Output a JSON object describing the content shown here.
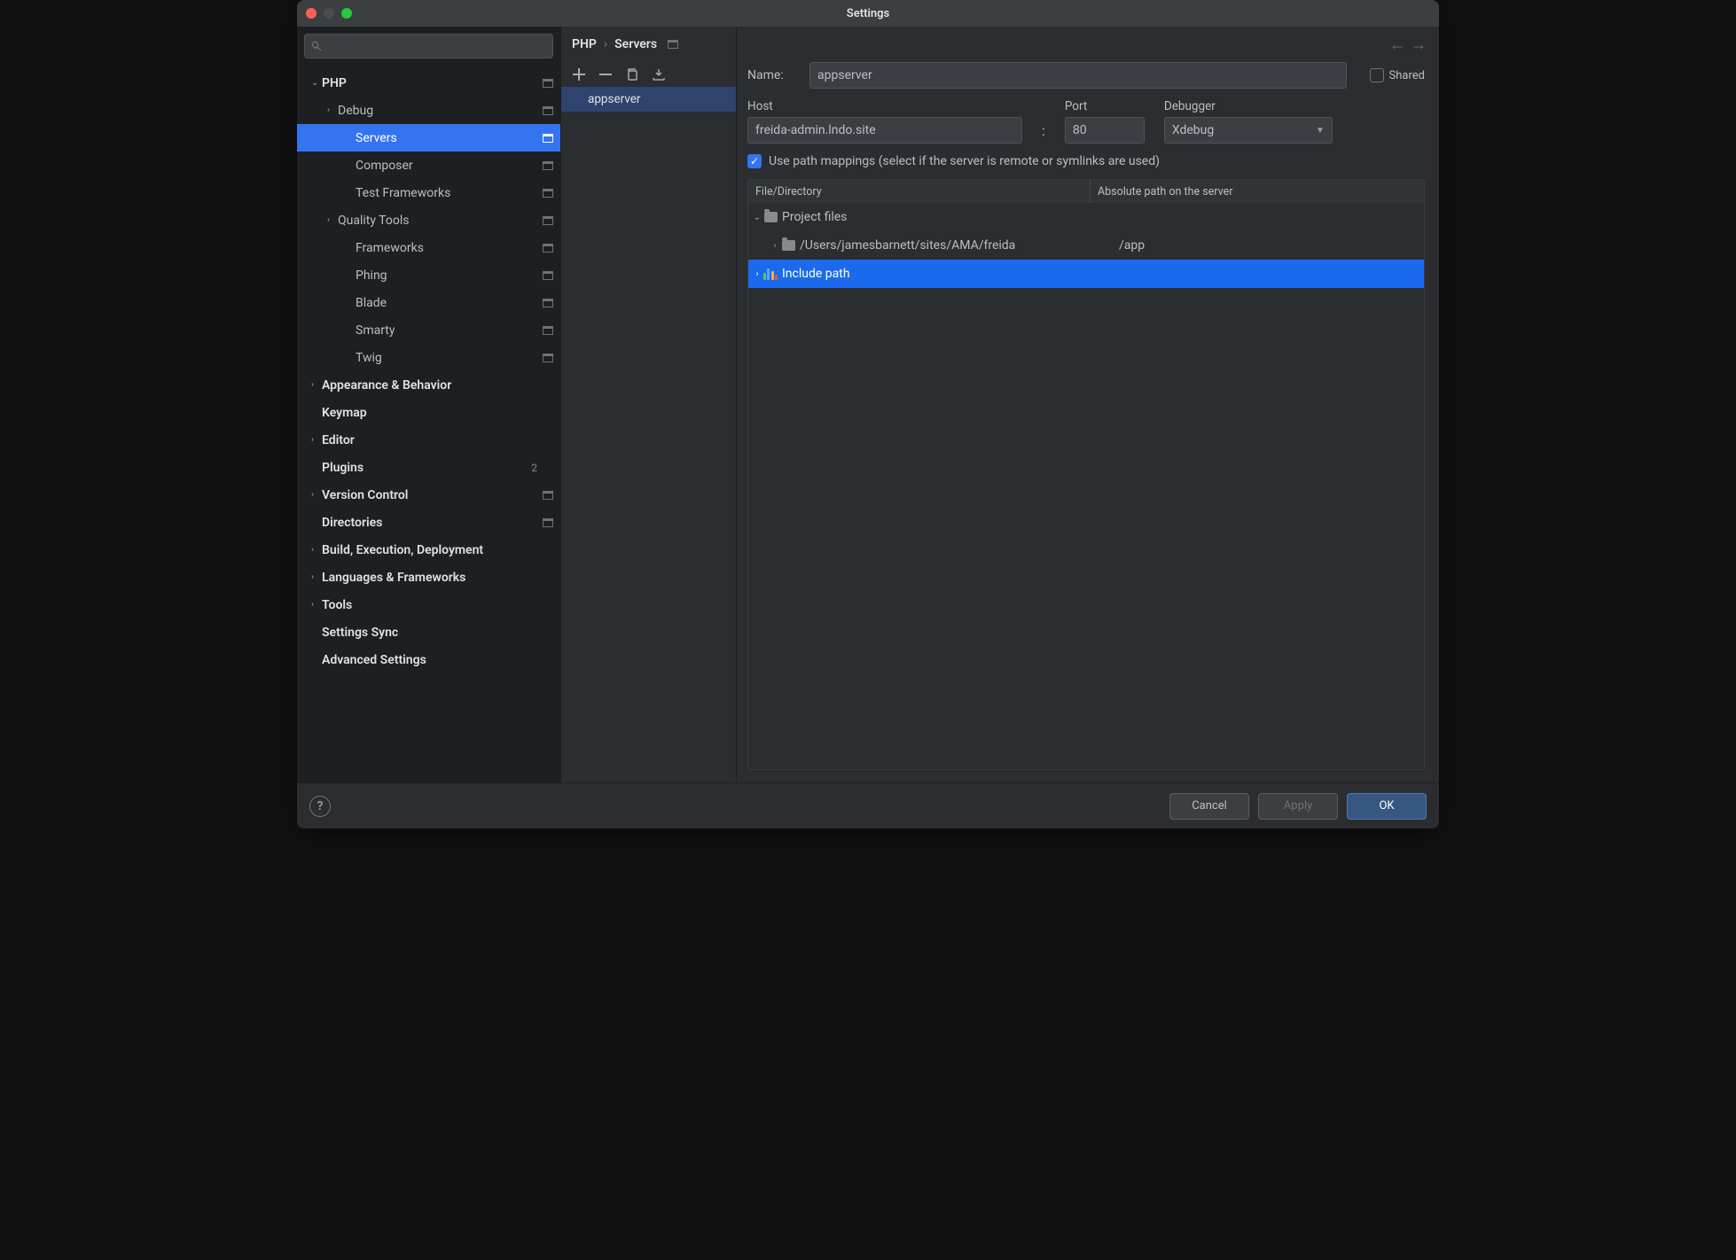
{
  "window": {
    "title": "Settings"
  },
  "sidebar": {
    "search_placeholder": "",
    "items": [
      {
        "label": "PHP",
        "depth": 0,
        "arrow": "⌄",
        "bold": true,
        "scope": true
      },
      {
        "label": "Debug",
        "depth": 1,
        "arrow": "›",
        "bold": false,
        "scope": true
      },
      {
        "label": "Servers",
        "depth": 2,
        "arrow": "",
        "bold": false,
        "scope": true,
        "selected": true
      },
      {
        "label": "Composer",
        "depth": 2,
        "arrow": "",
        "bold": false,
        "scope": true
      },
      {
        "label": "Test Frameworks",
        "depth": 2,
        "arrow": "",
        "bold": false,
        "scope": true
      },
      {
        "label": "Quality Tools",
        "depth": 1,
        "arrow": "›",
        "bold": false,
        "scope": true
      },
      {
        "label": "Frameworks",
        "depth": 2,
        "arrow": "",
        "bold": false,
        "scope": true
      },
      {
        "label": "Phing",
        "depth": 2,
        "arrow": "",
        "bold": false,
        "scope": true
      },
      {
        "label": "Blade",
        "depth": 2,
        "arrow": "",
        "bold": false,
        "scope": true
      },
      {
        "label": "Smarty",
        "depth": 2,
        "arrow": "",
        "bold": false,
        "scope": true
      },
      {
        "label": "Twig",
        "depth": 2,
        "arrow": "",
        "bold": false,
        "scope": true
      },
      {
        "label": "Appearance & Behavior",
        "depth": 0,
        "arrow": "›",
        "bold": true,
        "scope": false
      },
      {
        "label": "Keymap",
        "depth": 0,
        "arrow": "",
        "bold": true,
        "scope": false
      },
      {
        "label": "Editor",
        "depth": 0,
        "arrow": "›",
        "bold": true,
        "scope": false
      },
      {
        "label": "Plugins",
        "depth": 0,
        "arrow": "",
        "bold": true,
        "scope": false,
        "badge": "2"
      },
      {
        "label": "Version Control",
        "depth": 0,
        "arrow": "›",
        "bold": true,
        "scope": true
      },
      {
        "label": "Directories",
        "depth": 0,
        "arrow": "",
        "bold": true,
        "scope": true
      },
      {
        "label": "Build, Execution, Deployment",
        "depth": 0,
        "arrow": "›",
        "bold": true,
        "scope": false
      },
      {
        "label": "Languages & Frameworks",
        "depth": 0,
        "arrow": "›",
        "bold": true,
        "scope": false
      },
      {
        "label": "Tools",
        "depth": 0,
        "arrow": "›",
        "bold": true,
        "scope": false
      },
      {
        "label": "Settings Sync",
        "depth": 0,
        "arrow": "",
        "bold": true,
        "scope": false
      },
      {
        "label": "Advanced Settings",
        "depth": 0,
        "arrow": "",
        "bold": true,
        "scope": false
      }
    ]
  },
  "breadcrumb": {
    "root": "PHP",
    "sep": "›",
    "leaf": "Servers"
  },
  "servers": {
    "toolbar": {
      "add": "+",
      "remove": "−",
      "copy": "⧉",
      "import": "⭳"
    },
    "items": [
      "appserver"
    ]
  },
  "detail": {
    "name_label": "Name:",
    "name_value": "appserver",
    "shared_label": "Shared",
    "shared_checked": false,
    "host_label": "Host",
    "host_value": "freida-admin.lndo.site",
    "port_label": "Port",
    "port_value": "80",
    "debugger_label": "Debugger",
    "debugger_value": "Xdebug",
    "colon": ":",
    "use_path_label": "Use path mappings (select if the server is remote or symlinks are used)",
    "use_path_checked": true,
    "table": {
      "col1": "File/Directory",
      "col2": "Absolute path on the server",
      "rows": [
        {
          "arrow": "⌄",
          "depth": 0,
          "icon": "folder",
          "label": "Project files",
          "value": ""
        },
        {
          "arrow": "›",
          "depth": 1,
          "icon": "folder",
          "label": "/Users/jamesbarnett/sites/AMA/freida",
          "value": "/app"
        },
        {
          "arrow": "›",
          "depth": 0,
          "icon": "bars",
          "label": "Include path",
          "value": "",
          "selected": true
        }
      ]
    }
  },
  "footer": {
    "cancel": "Cancel",
    "apply": "Apply",
    "ok": "OK"
  }
}
